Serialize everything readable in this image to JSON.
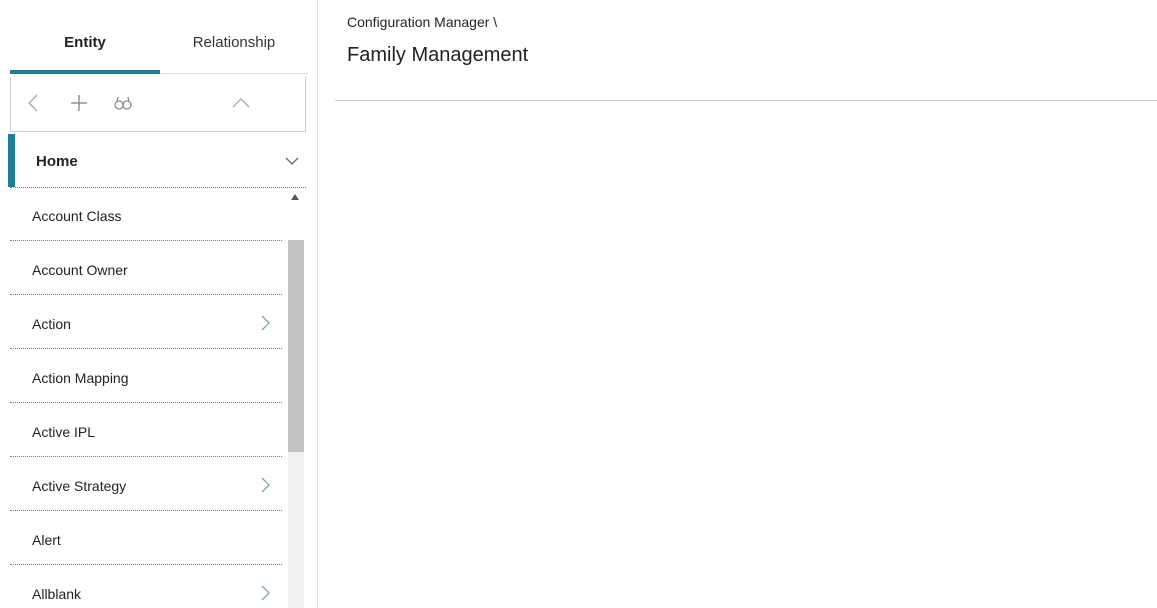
{
  "tabs": [
    {
      "label": "Entity",
      "active": true
    },
    {
      "label": "Relationship",
      "active": false
    }
  ],
  "toolbar": {
    "icons": [
      "chevron-left-icon",
      "plus-icon",
      "binoculars-icon",
      "chevron-up-icon"
    ]
  },
  "home": {
    "label": "Home"
  },
  "list": [
    {
      "label": "Account Class",
      "has_children": false
    },
    {
      "label": "Account Owner",
      "has_children": false
    },
    {
      "label": "Action",
      "has_children": true
    },
    {
      "label": "Action Mapping",
      "has_children": false
    },
    {
      "label": "Active IPL",
      "has_children": false
    },
    {
      "label": "Active Strategy",
      "has_children": true
    },
    {
      "label": "Alert",
      "has_children": false
    },
    {
      "label": "Allblank",
      "has_children": true
    }
  ],
  "breadcrumb": "Configuration Manager \\",
  "page_title": "Family Management",
  "colors": {
    "accent": "#1b7e93"
  }
}
